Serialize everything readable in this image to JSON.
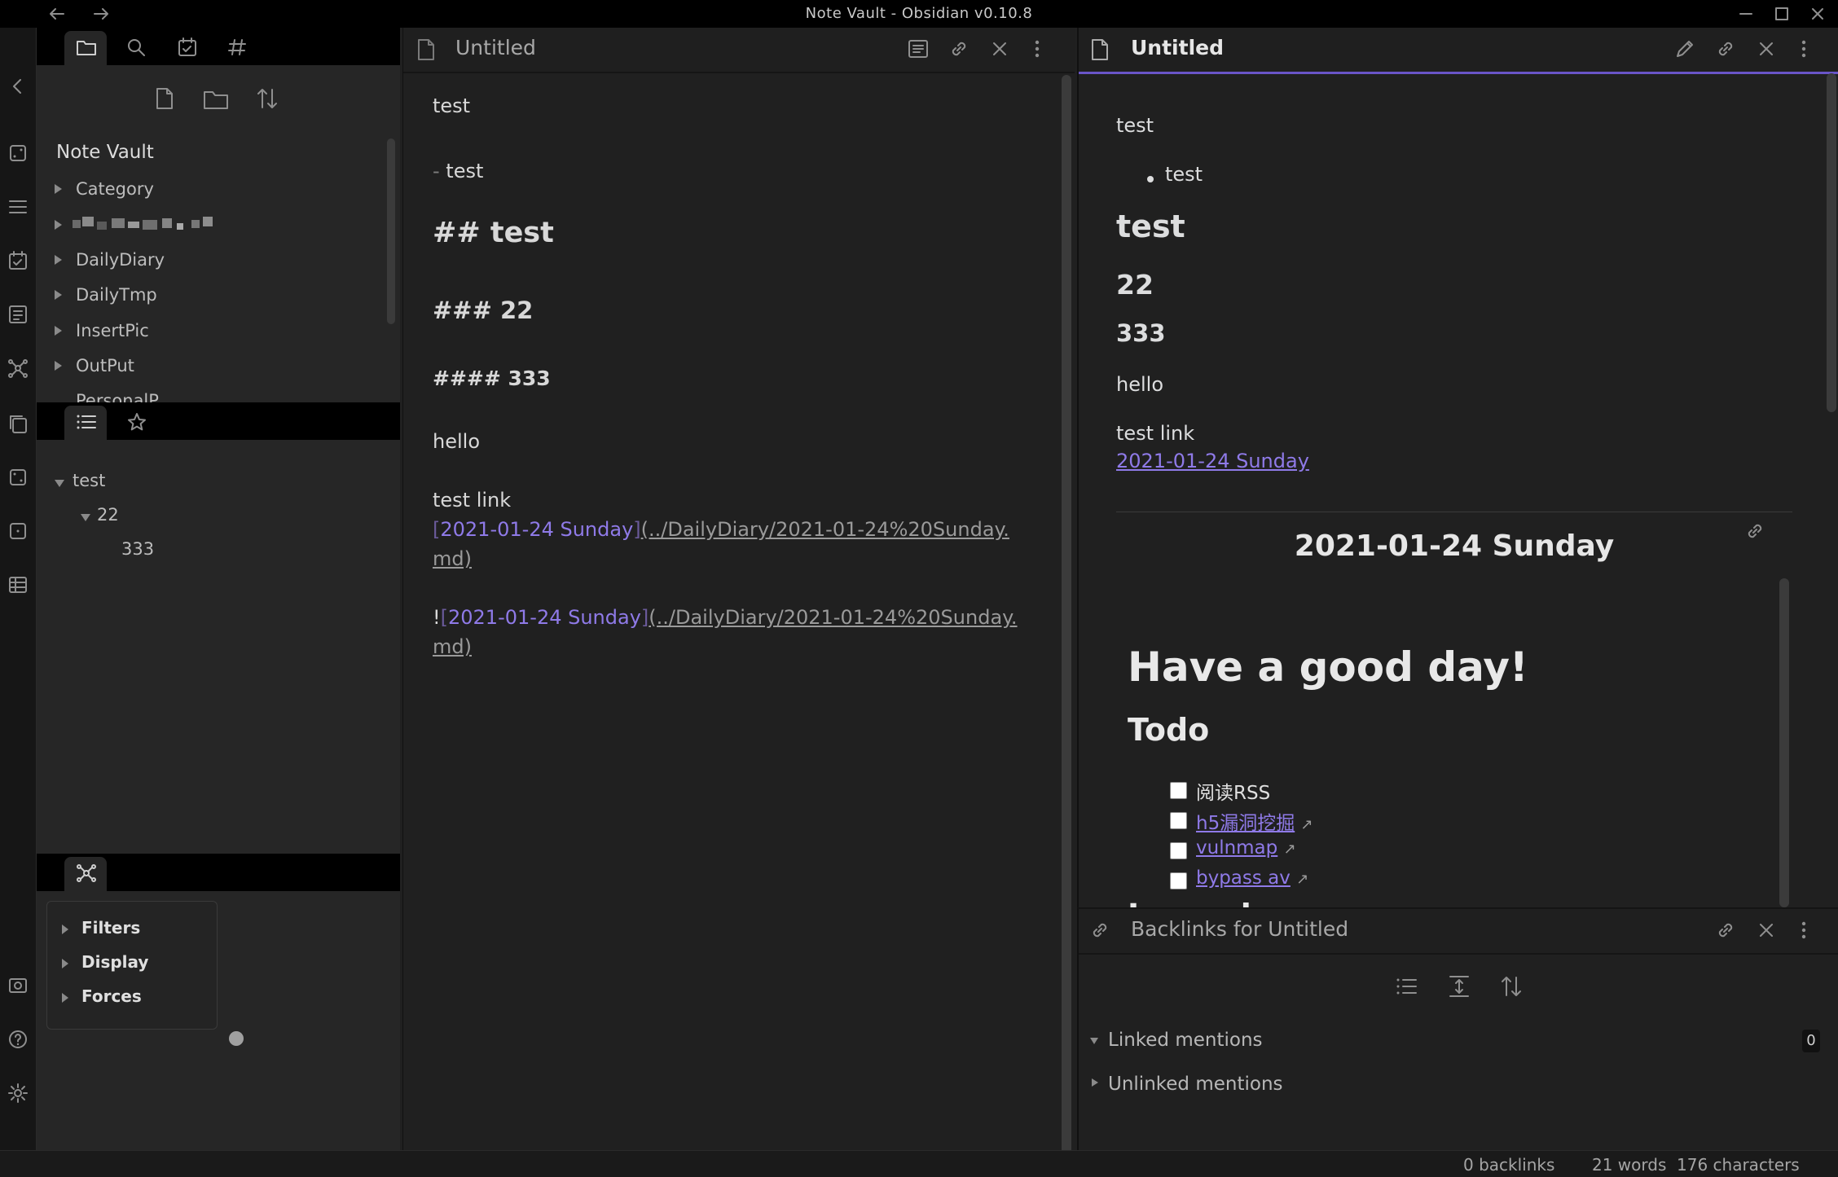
{
  "window": {
    "title": "Note Vault - Obsidian v0.10.8"
  },
  "file_explorer": {
    "vault_name": "Note Vault",
    "folders": [
      "Category",
      "DailyDiary",
      "DailyTmp",
      "InsertPic",
      "OutPut",
      "PersonalP..."
    ]
  },
  "outline": {
    "items": [
      {
        "label": "test",
        "level": 1
      },
      {
        "label": "22",
        "level": 2
      },
      {
        "label": "333",
        "level": 3
      }
    ]
  },
  "graph_controls": {
    "items": [
      "Filters",
      "Display",
      "Forces"
    ]
  },
  "editor": {
    "title": "Untitled",
    "lines": {
      "l1": "test",
      "l2_marker": "- ",
      "l2_text": "test",
      "h2": "## test",
      "h3": "### 22",
      "h4": "#### 333",
      "hello": "hello",
      "test_link": "test link",
      "link_open": "[",
      "link_text": "2021-01-24 Sunday",
      "link_close": "]",
      "link_url_1": "(../DailyDiary/2021-01-24%20Sunday.",
      "link_url_2": "md)",
      "embed_bang": "!",
      "embed_url_1": "(../DailyDiary/2021-01-24%20Sunday.",
      "embed_url_2": "md)"
    }
  },
  "preview": {
    "title": "Untitled",
    "p1": "test",
    "bullet": "test",
    "h2": "test",
    "h3": "22",
    "h4": "333",
    "hello": "hello",
    "test_link": "test link",
    "link": "2021-01-24 Sunday",
    "embed": {
      "title": "2021-01-24 Sunday",
      "h1": "Have a good day!",
      "h2": "Todo",
      "todos": [
        {
          "label": "阅读RSS",
          "link": false
        },
        {
          "label": "h5漏洞挖掘",
          "link": true
        },
        {
          "label": "vulnmap",
          "link": true
        },
        {
          "label": "bypass av",
          "link": true
        }
      ],
      "next_heading_partial": "Journal"
    }
  },
  "backlinks": {
    "title": "Backlinks for Untitled",
    "linked_mentions": "Linked mentions",
    "linked_count": "0",
    "unlinked_mentions": "Unlinked mentions"
  },
  "status_bar": {
    "backlinks": "0 backlinks",
    "words": "21 words",
    "characters": "176 characters"
  }
}
